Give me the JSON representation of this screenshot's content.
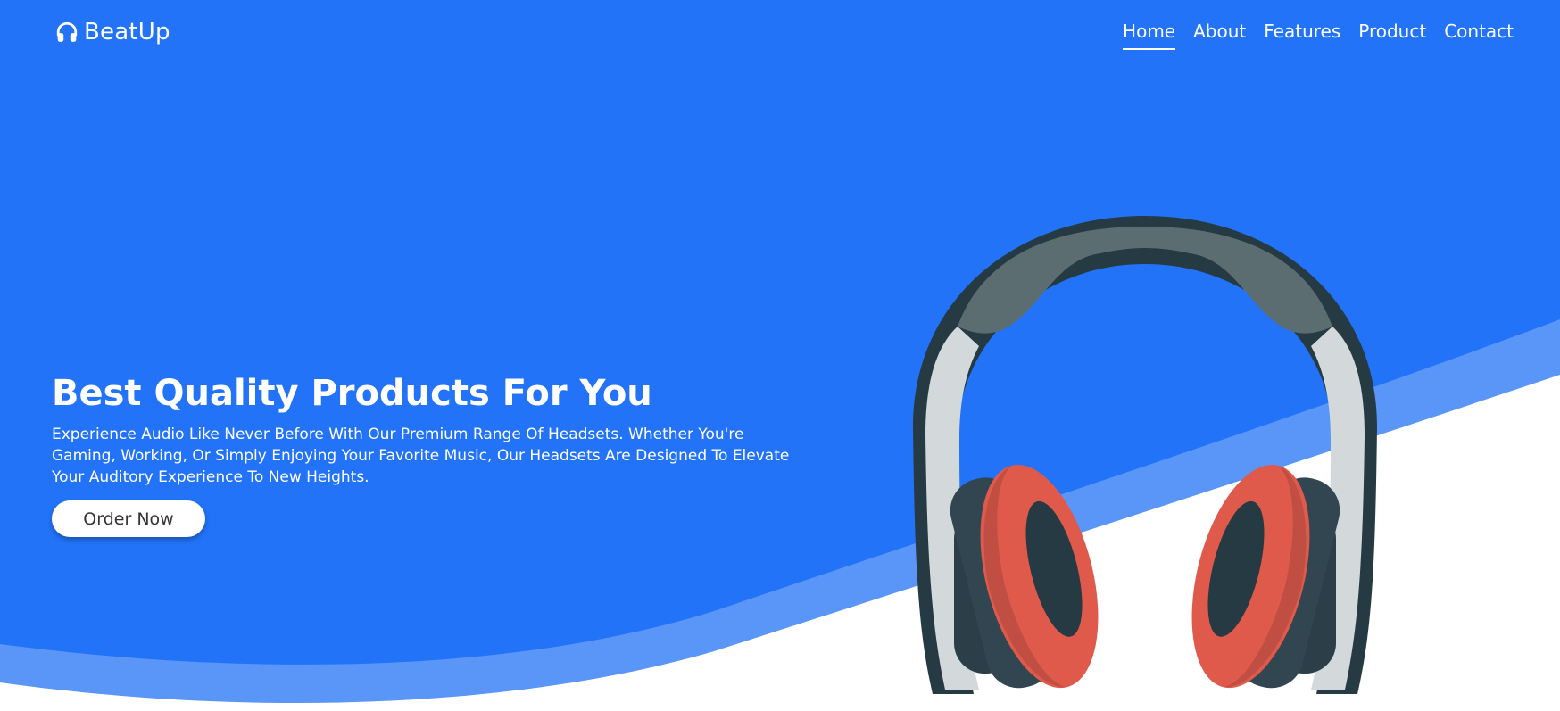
{
  "brand": {
    "name": "BeatUp",
    "icon": "headphones-icon"
  },
  "nav": {
    "items": [
      {
        "label": "Home",
        "active": true
      },
      {
        "label": "About",
        "active": false
      },
      {
        "label": "Features",
        "active": false
      },
      {
        "label": "Product",
        "active": false
      },
      {
        "label": "Contact",
        "active": false
      }
    ]
  },
  "hero": {
    "title": "Best Quality Products For You",
    "description": "Experience Audio Like Never Before With Our Premium Range Of Headsets. Whether You're Gaming, Working, Or Simply Enjoying Your Favorite Music, Our Headsets Are Designed To Elevate Your Auditory Experience To New Heights.",
    "cta_label": "Order Now",
    "image": "headphones-illustration"
  },
  "colors": {
    "primary_blue": "#2273f7",
    "wave_light_blue": "#5a95f8",
    "background_white": "#ffffff",
    "earcup_red": "#e05a4c",
    "band_gray": "#5c6d71",
    "frame_dark": "#263a43"
  }
}
